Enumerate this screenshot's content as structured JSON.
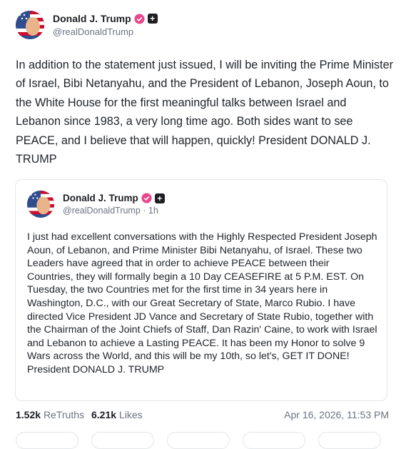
{
  "post": {
    "author_name": "Donald J. Trump",
    "author_handle": "@realDonaldTrump",
    "text": "In addition to the statement just issued, I will be inviting the Prime Minister of Israel, Bibi Netanyahu, and the President of Lebanon, Joseph Aoun, to the White House for the first meaningful talks between Israel and Lebanon since 1983, a very long time ago. Both sides want to see PEACE, and I believe that will happen, quickly! President DONALD J. TRUMP",
    "badge_plus": "+"
  },
  "quote": {
    "author_name": "Donald J. Trump",
    "author_handle": "@realDonaldTrump · 1h",
    "text": "I just had excellent conversations with the Highly Respected President Joseph Aoun, of Lebanon, and Prime Minister Bibi Netanyahu, of Israel. These two Leaders have agreed that in order to achieve PEACE between their Countries, they will formally begin a 10 Day CEASEFIRE at 5 P.M. EST. On Tuesday, the two Countries met for the first time in 34 years here in Washington, D.C., with our Great Secretary of State, Marco Rubio. I have directed Vice President JD Vance and Secretary of State Rubio, together with the Chairman of the Joint Chiefs of Staff, Dan Razin' Caine, to work with Israel and Lebanon to achieve a Lasting PEACE. It has been my Honor to solve 9 Wars across the World, and this will be my 10th, so let's, GET IT DONE! President DONALD J. TRUMP",
    "badge_plus": "+"
  },
  "stats": {
    "retruths_count": "1.52k",
    "retruths_label": "ReTruths",
    "likes_count": "6.21k",
    "likes_label": "Likes",
    "timestamp": "Apr 16, 2026, 11:53 PM"
  },
  "colors": {
    "verified": "#e8488b",
    "text": "#1f2328",
    "muted": "#6b7280",
    "border": "#e3e5e8"
  },
  "icons": {
    "verified": "verified-badge-icon",
    "plus": "plus-badge-icon"
  }
}
